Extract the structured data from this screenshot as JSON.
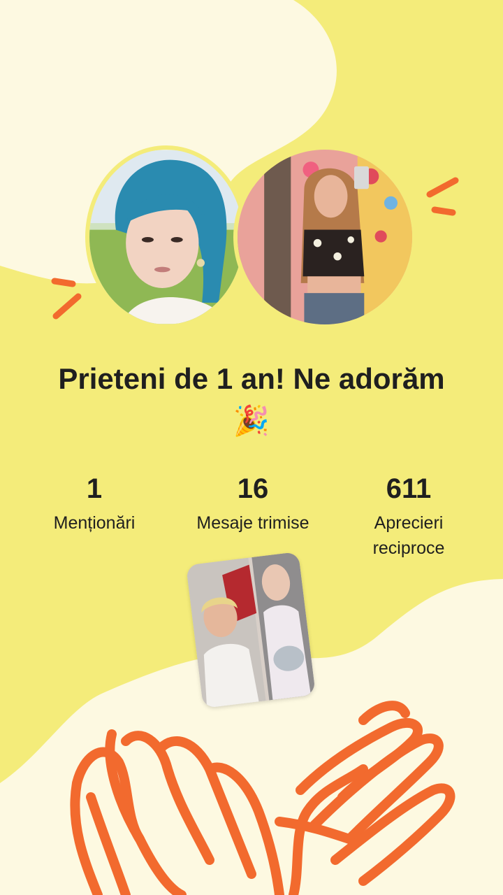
{
  "headline": "Prieteni de 1 an! Ne adorăm 🎉",
  "stats": [
    {
      "value": "1",
      "label": "Menționări"
    },
    {
      "value": "16",
      "label": "Mesaje trimise"
    },
    {
      "value": "611",
      "label": "Aprecieri reciproce"
    }
  ],
  "colors": {
    "background": "#f4ec7a",
    "cream": "#fdf9e1",
    "accent": "#f26a2e",
    "text": "#1f1f1f"
  }
}
